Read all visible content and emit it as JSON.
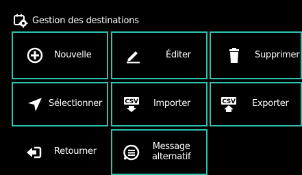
{
  "header": {
    "title": "Gestion des destinations",
    "icon": "calendar-gear-icon"
  },
  "buttons": {
    "new": {
      "label": "Nouvelle",
      "icon": "plus-circle-icon"
    },
    "edit": {
      "label": "Éditer",
      "icon": "pencil-icon"
    },
    "delete": {
      "label": "Supprimer",
      "icon": "trash-icon"
    },
    "select": {
      "label": "Sélectionner",
      "icon": "location-arrow-icon"
    },
    "import": {
      "label": "Importer",
      "icon": "csv-import-icon"
    },
    "export": {
      "label": "Exporter",
      "icon": "csv-export-icon"
    },
    "back": {
      "label": "Retourner",
      "icon": "back-arrow-icon"
    },
    "alt_message": {
      "label_line1": "Message",
      "label_line2": "alternatif",
      "icon": "message-icon"
    }
  },
  "colors": {
    "accent": "#2fc4b2",
    "background": "#000000",
    "text": "#ffffff"
  }
}
